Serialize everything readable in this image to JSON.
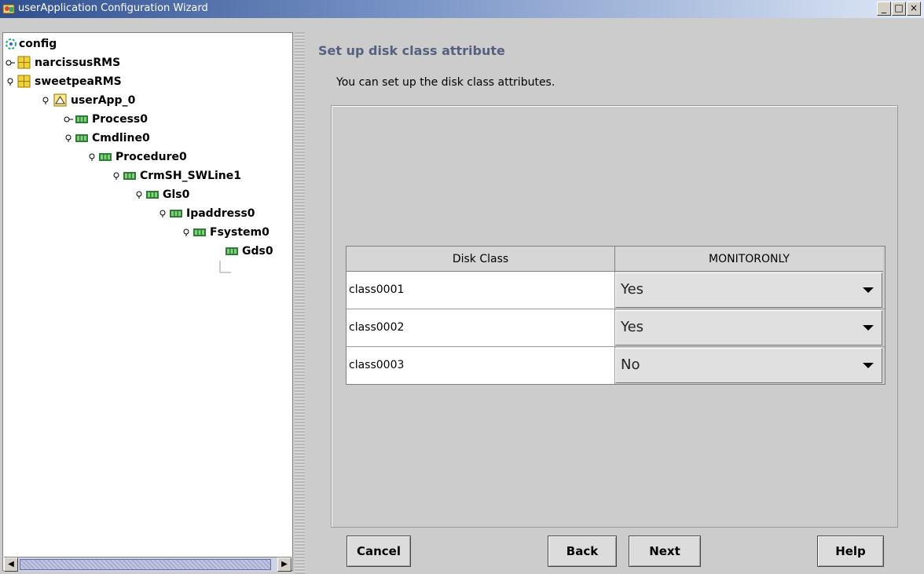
{
  "window": {
    "title": "userApplication Configuration Wizard",
    "buttons": {
      "minimize": "_",
      "maximize": "□",
      "close": "×"
    }
  },
  "tree": {
    "nodes": [
      {
        "label": "config",
        "icon": "config-icon"
      },
      {
        "label": "narcissusRMS",
        "icon": "host-icon"
      },
      {
        "label": "sweetpeaRMS",
        "icon": "host-icon"
      },
      {
        "label": "userApp_0",
        "icon": "userapp-icon"
      },
      {
        "label": "Process0",
        "icon": "resource-icon"
      },
      {
        "label": "Cmdline0",
        "icon": "resource-icon"
      },
      {
        "label": "Procedure0",
        "icon": "resource-icon"
      },
      {
        "label": "CrmSH_SWLine1",
        "icon": "resource-icon"
      },
      {
        "label": "Gls0",
        "icon": "resource-icon"
      },
      {
        "label": "Ipaddress0",
        "icon": "resource-icon"
      },
      {
        "label": "Fsystem0",
        "icon": "resource-icon"
      },
      {
        "label": "Gds0",
        "icon": "resource-icon",
        "selected": true
      }
    ]
  },
  "main": {
    "section_title": "Set up disk class attribute",
    "description": "You can set up the disk class attributes.",
    "table": {
      "headers": [
        "Disk Class",
        "MONITORONLY"
      ],
      "rows": [
        {
          "disk_class": "class0001",
          "monitoronly": "Yes"
        },
        {
          "disk_class": "class0002",
          "monitoronly": "Yes"
        },
        {
          "disk_class": "class0003",
          "monitoronly": "No"
        }
      ]
    }
  },
  "buttons": {
    "cancel": "Cancel",
    "back": "Back",
    "next": "Next",
    "help": "Help"
  },
  "colors": {
    "title_accent": "#57607f",
    "titlebar_start": "#2f4f8f",
    "resource_icon_green": "#2e7d32",
    "host_icon_yellow": "#e6c200"
  }
}
